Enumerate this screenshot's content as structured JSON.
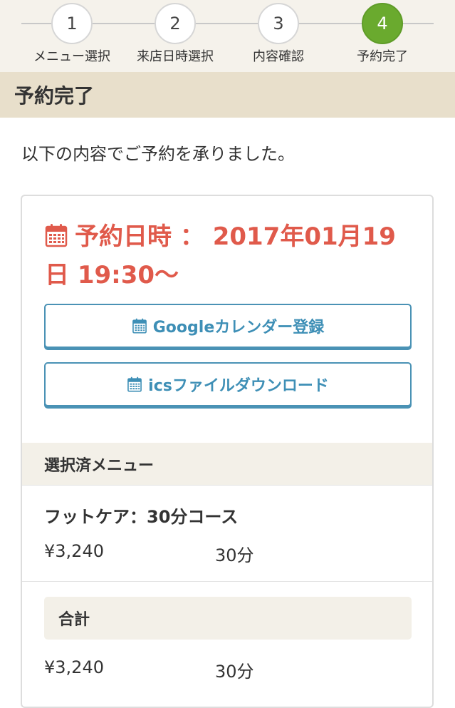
{
  "steps": [
    {
      "number": "1",
      "label": "メニュー選択",
      "active": false
    },
    {
      "number": "2",
      "label": "来店日時選択",
      "active": false
    },
    {
      "number": "3",
      "label": "内容確認",
      "active": false
    },
    {
      "number": "4",
      "label": "予約完了",
      "active": true
    }
  ],
  "page": {
    "title": "予約完了",
    "intro": "以下の内容でご予約を承りました。"
  },
  "reservation": {
    "datetime_label": "予約日時",
    "separator": "：",
    "datetime_value": "2017年01月19日 19:30〜"
  },
  "buttons": {
    "google_calendar": "Googleカレンダー登録",
    "ics_download": "icsファイルダウンロード"
  },
  "selected_menu": {
    "heading": "選択済メニュー",
    "items": [
      {
        "name": "フットケア：30分コース",
        "price": "¥3,240",
        "duration": "30分"
      }
    ]
  },
  "total": {
    "label": "合計",
    "price": "¥3,240",
    "duration": "30分"
  },
  "colors": {
    "accent_red": "#e05a4b",
    "button_blue": "#3e8fb6",
    "active_step_green": "#6aaa2e",
    "header_beige": "#e8dfcb"
  },
  "icons": {
    "calendar": "calendar-icon"
  }
}
